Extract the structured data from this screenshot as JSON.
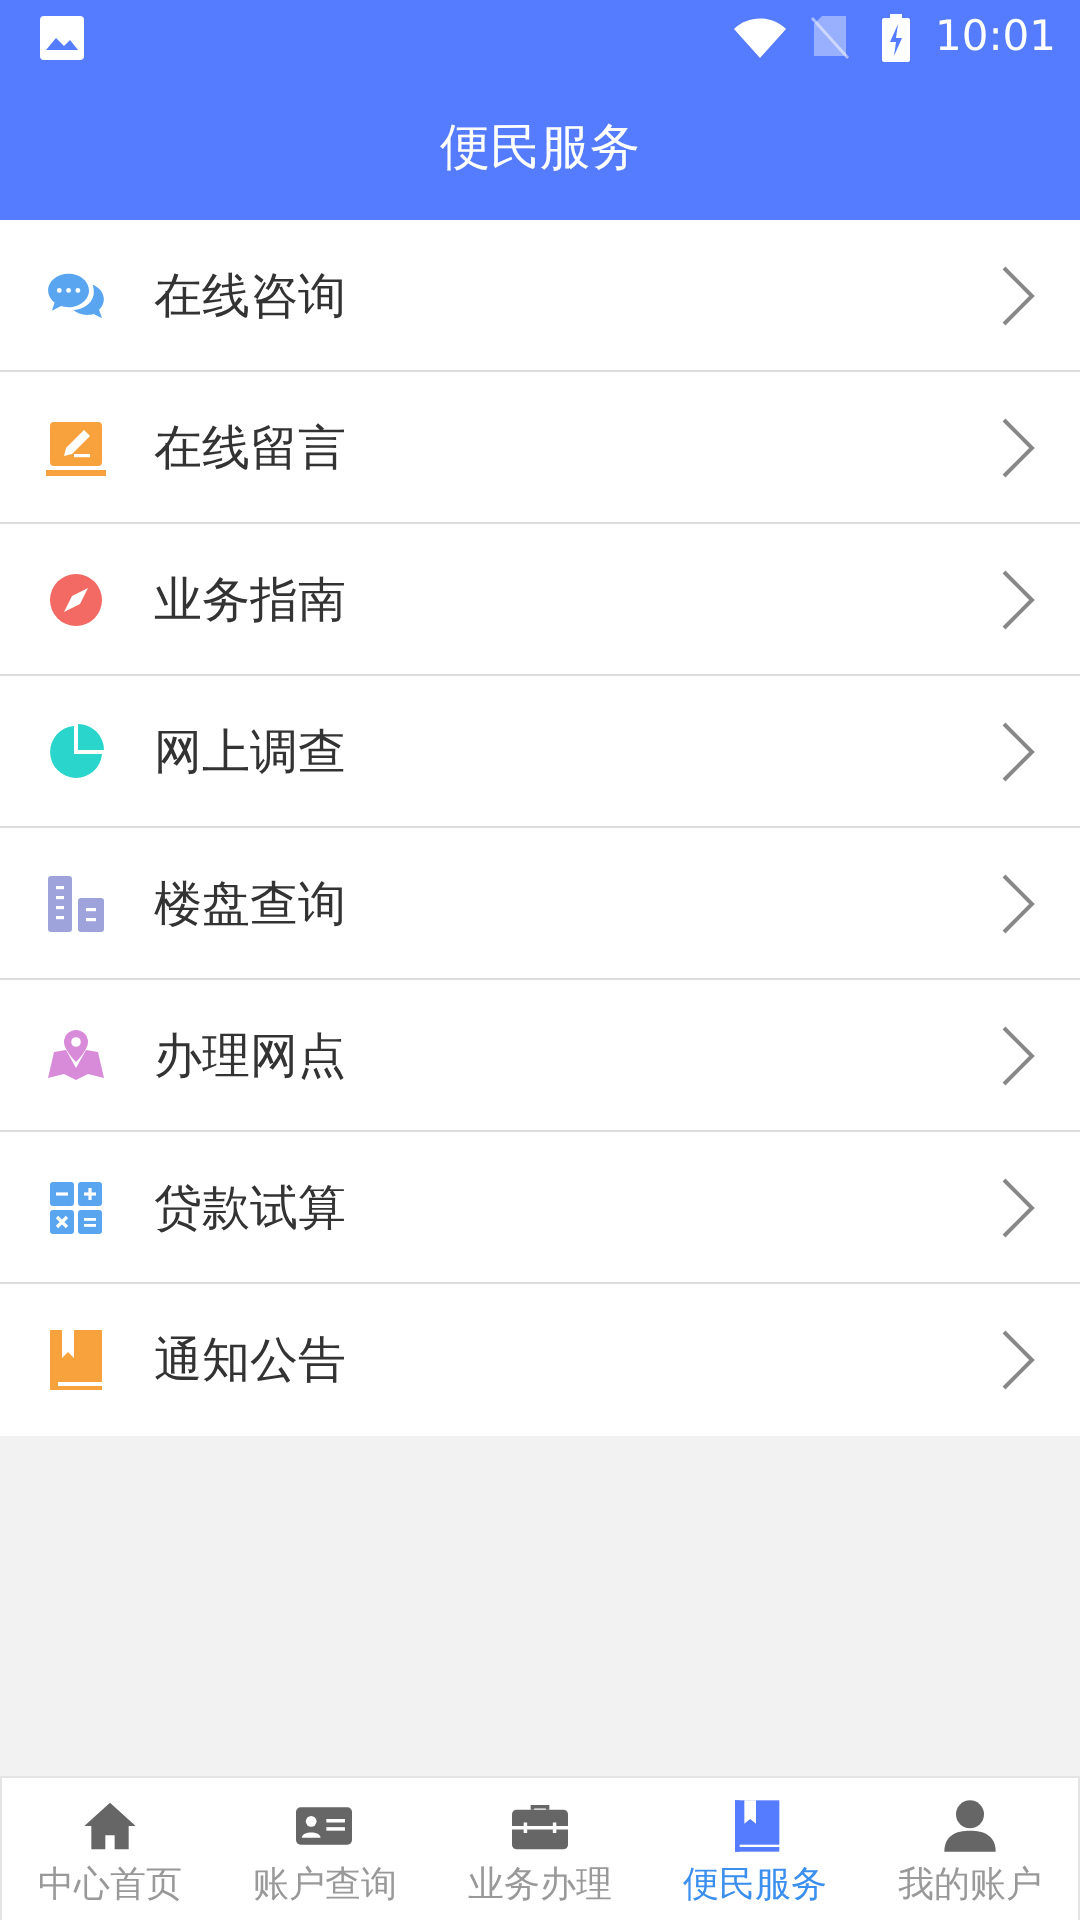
{
  "status_bar": {
    "time": "10:01"
  },
  "header": {
    "title": "便民服务"
  },
  "menu": [
    {
      "label": "在线咨询"
    },
    {
      "label": "在线留言"
    },
    {
      "label": "业务指南"
    },
    {
      "label": "网上调查"
    },
    {
      "label": "楼盘查询"
    },
    {
      "label": "办理网点"
    },
    {
      "label": "贷款试算"
    },
    {
      "label": "通知公告"
    }
  ],
  "tabs": [
    {
      "label": "中心首页",
      "selected": false
    },
    {
      "label": "账户查询",
      "selected": false
    },
    {
      "label": "业务办理",
      "selected": false
    },
    {
      "label": "便民服务",
      "selected": true
    },
    {
      "label": "我的账户",
      "selected": false
    }
  ]
}
